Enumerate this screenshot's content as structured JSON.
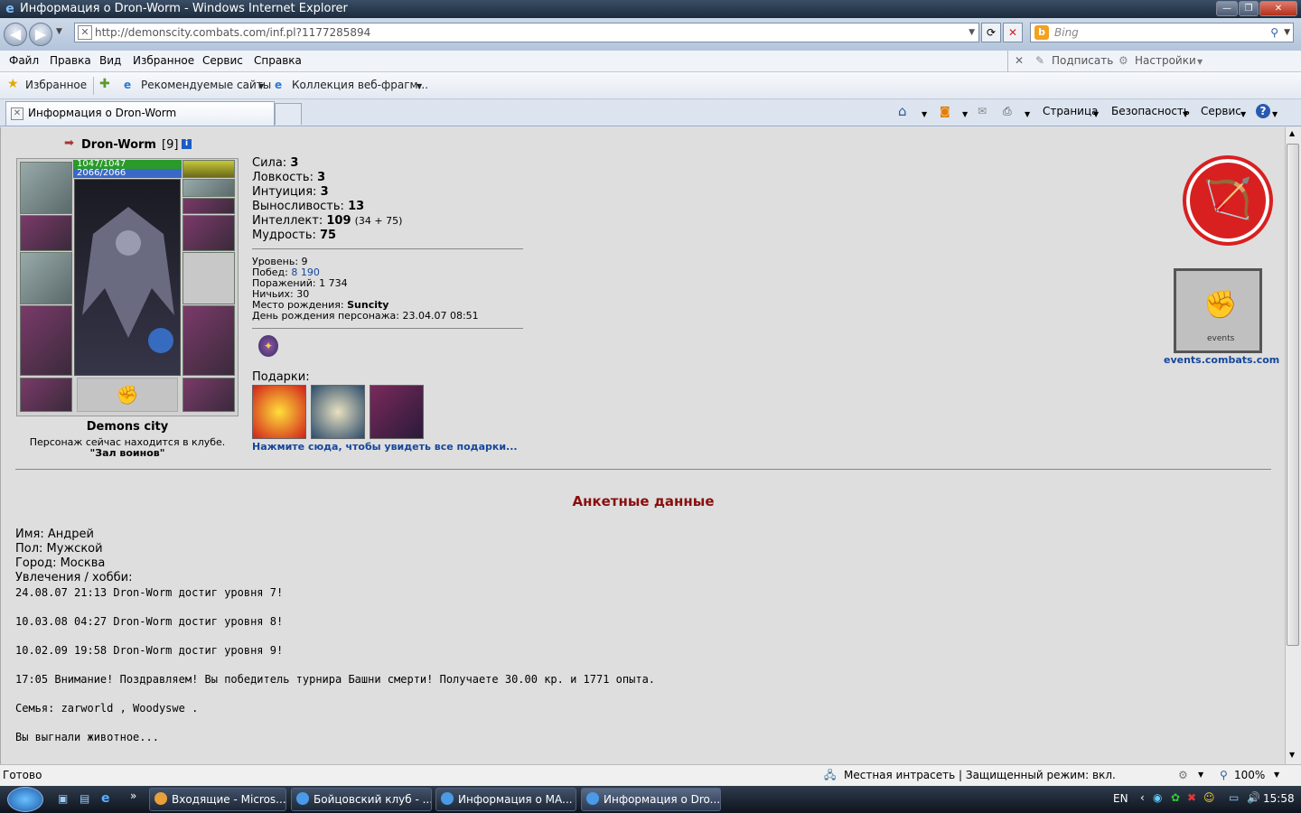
{
  "window": {
    "title": "Информация о Dron-Worm - Windows Internet Explorer",
    "min": "—",
    "max": "❐",
    "close": "✕"
  },
  "nav": {
    "back": "◀",
    "forward": "▶",
    "url": "http://demonscity.combats.com/inf.pl?1177285894",
    "search_placeholder": "Bing"
  },
  "menu": [
    "Файл",
    "Правка",
    "Вид",
    "Избранное",
    "Сервис",
    "Справка"
  ],
  "menu_right": {
    "subscribe": "Подписать",
    "settings": "Настройки"
  },
  "favbar": {
    "favorites": "Избранное",
    "suggested": "Рекомендуемые сайты",
    "gallery": "Коллекция веб-фрагм..."
  },
  "tab": {
    "title": "Информация о Dron-Worm"
  },
  "commandbar": {
    "page": "Страница",
    "safety": "Безопасность",
    "tools": "Сервис"
  },
  "character": {
    "name": "Dron-Worm",
    "level_tag": "[9]",
    "hp": "1047/1047",
    "mana": "2066/2066",
    "city": "Demons city",
    "location_text": "Персонаж сейчас находится в клубе.",
    "location_place": "\"Зал воинов\""
  },
  "stats": [
    {
      "label": "Сила:",
      "value": "3",
      "extra": ""
    },
    {
      "label": "Ловкость:",
      "value": "3",
      "extra": ""
    },
    {
      "label": "Интуиция:",
      "value": "3",
      "extra": ""
    },
    {
      "label": "Выносливость:",
      "value": "13",
      "extra": ""
    },
    {
      "label": "Интеллект:",
      "value": "109",
      "extra": "(34 + 75)"
    },
    {
      "label": "Мудрость:",
      "value": "75",
      "extra": ""
    }
  ],
  "info": {
    "level_label": "Уровень:",
    "level": "9",
    "wins_label": "Побед:",
    "wins": "8 190",
    "losses_label": "Поражений:",
    "losses": "1 734",
    "draws_label": "Ничьих:",
    "draws": "30",
    "birthplace_label": "Место рождения:",
    "birthplace": "Suncity",
    "birthday_label": "День рождения персонажа:",
    "birthday": "23.04.07 08:51"
  },
  "gifts": {
    "label": "Подарки:",
    "link": "Нажмите сюда, чтобы увидеть все подарки..."
  },
  "events_link": "events.combats.com",
  "events_badge": "events",
  "profile": {
    "title": "Анкетные данные",
    "name": "Имя: Андрей",
    "gender": "Пол: Мужской",
    "city": "Город: Москва",
    "hobbies": "Увлечения / хобби:",
    "lines": [
      "24.08.07 21:13 Dron-Worm достиг уровня 7!",
      "10.03.08 04:27 Dron-Worm достиг уровня 8!",
      "10.02.09 19:58 Dron-Worm достиг уровня 9!",
      "17:05 Внимание! Поздравляем! Вы победитель турнира Башни смерти! Получаете 30.00 кр. и 1771 опыта.",
      "Семья: zarworld , Woodyswe .",
      "Вы выгнали животное..."
    ]
  },
  "status": {
    "ready": "Готово",
    "zone": "Местная интрасеть | Защищенный режим: вкл.",
    "zoom": "100%"
  },
  "taskbar": {
    "tasks": [
      "Входящие - Micros...",
      "Бойцовский клуб - ...",
      "Информация о МА...",
      "Информация о Dro..."
    ],
    "lang": "EN",
    "clock": "15:58"
  }
}
